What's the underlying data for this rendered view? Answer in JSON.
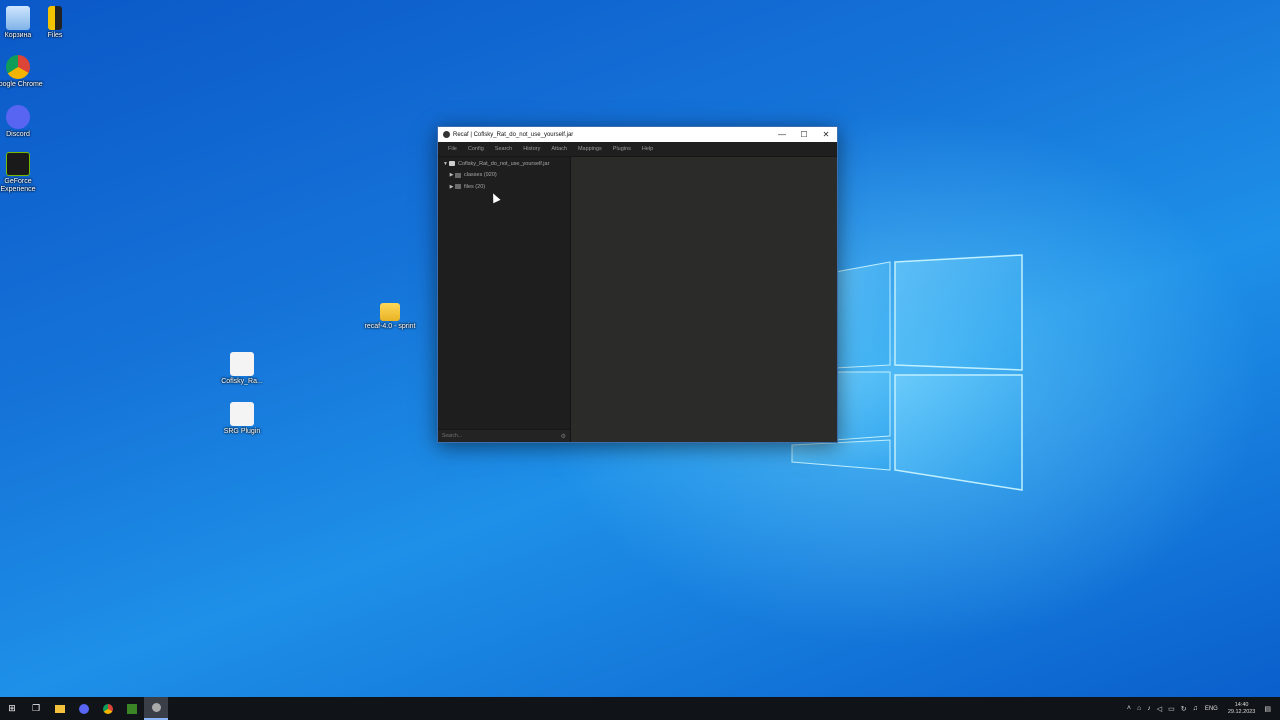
{
  "desktop": {
    "icons": [
      {
        "label": "Корзина",
        "icon": "recycle-bin-icon"
      },
      {
        "label": "Files",
        "icon": "files-icon"
      },
      {
        "label": "Google Chrome",
        "icon": "chrome-icon"
      },
      {
        "label": "Discord",
        "icon": "discord-icon"
      },
      {
        "label": "GeForce Experience",
        "icon": "nvidia-icon"
      },
      {
        "label": "recaf-4.0 - sprint",
        "icon": "folder-icon"
      },
      {
        "label": "Coflsky_Ra...",
        "icon": "java-jar-icon"
      },
      {
        "label": "SRG Plugin",
        "icon": "java-jar-icon"
      }
    ]
  },
  "window": {
    "title": "Recaf | Coflsky_Rat_do_not_use_yourself.jar",
    "controls": {
      "minimize": "—",
      "maximize": "☐",
      "close": "✕"
    },
    "menu": [
      "File",
      "Config",
      "Search",
      "History",
      "Attach",
      "Mappings",
      "Plugins",
      "Help"
    ],
    "tree": {
      "root": "Coflsky_Rat_do_not_use_yourself.jar",
      "children": [
        "classes (920)",
        "files (20)"
      ]
    },
    "search_placeholder": "Search..."
  },
  "taskbar": {
    "apps": [
      "start-icon",
      "task-view-icon",
      "file-explorer-icon",
      "discord-icon",
      "chrome-icon",
      "minecraft-icon",
      "recaf-icon"
    ],
    "language": "ENG",
    "time": "14:40",
    "date": "29.12.2023"
  },
  "colors": {
    "window_bg": "#2b2b2b",
    "menubar_bg": "#1f1f1f",
    "tree_bg": "#1e1e1e",
    "taskbar_bg": "#101418"
  }
}
